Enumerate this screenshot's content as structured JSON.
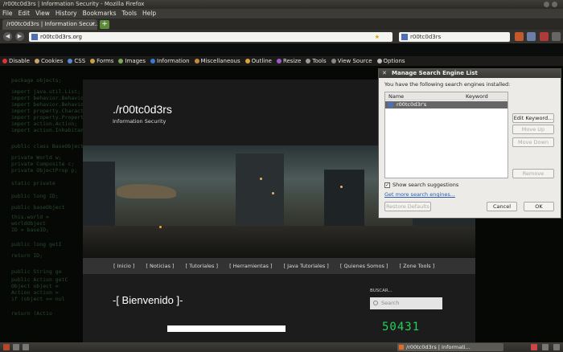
{
  "window": {
    "title": "/r00tc0d3rs | Information Security - Mozilla Firefox"
  },
  "menu": [
    "File",
    "Edit",
    "View",
    "History",
    "Bookmarks",
    "Tools",
    "Help"
  ],
  "tab": {
    "label": "/r00tc0d3rs | Information Secur..."
  },
  "url": "r00tc0d3rs.org",
  "search_engine_field": "r00tc0d3rs",
  "devtools": [
    "Disable",
    "Cookies",
    "CSS",
    "Forms",
    "Images",
    "Information",
    "Miscellaneous",
    "Outline",
    "Resize",
    "Tools",
    "View Source",
    "Options"
  ],
  "site": {
    "title": "./r00tc0d3rs",
    "description": "Information Security",
    "nav": [
      "[ Inicio ]",
      "[ Noticias ]",
      "[ Tutoriales ]",
      "[ Herramientas ]",
      "[ Java Tutoriales ]",
      "[ Quienes Somos ]",
      "[ Zone Tools ]"
    ],
    "welcome": "-[ Bienvenido ]-",
    "search_label": "BUSCAR...",
    "search_placeholder": "Search",
    "clock": "50431"
  },
  "dialog": {
    "title": "Manage Search Engine List",
    "intro": "You have the following search engines installed:",
    "col_name": "Name",
    "col_keyword": "Keyword",
    "engine_name": "r00tc0d3r's",
    "edit_keyword": "Edit Keyword...",
    "move_up": "Move Up",
    "move_down": "Move Down",
    "remove": "Remove",
    "show_suggestions": "Show search suggestions",
    "get_more": "Get more search engines...",
    "restore_defaults": "Restore Defaults",
    "cancel": "Cancel",
    "ok": "OK"
  },
  "taskbar": {
    "item": "/r00tc0d3rs | Informati..."
  },
  "colors": {
    "accent": "#4f6fb3",
    "clock": "#1fd35a"
  }
}
